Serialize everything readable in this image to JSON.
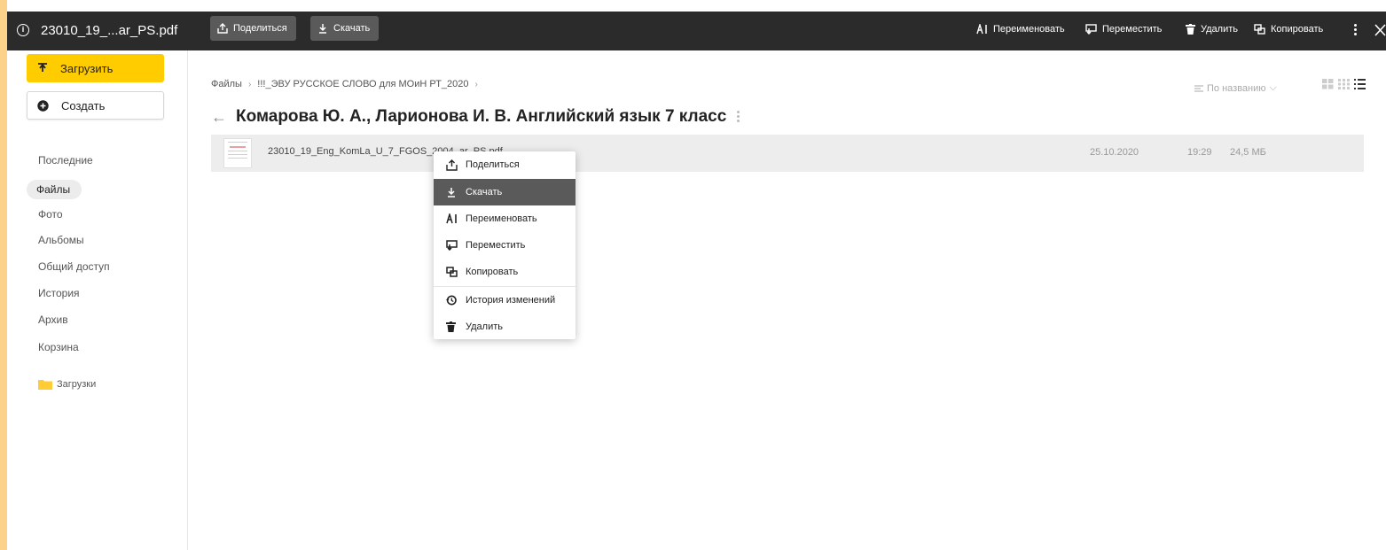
{
  "topbar": {
    "file_name": "23010_19_...ar_PS.pdf",
    "share_label": "Поделиться",
    "download_label": "Скачать",
    "rename_label": "Переименовать",
    "move_label": "Переместить",
    "delete_label": "Удалить",
    "copy_label": "Копировать"
  },
  "sidebar": {
    "upload_label": "Загрузить",
    "create_label": "Создать",
    "items": [
      {
        "label": "Последние"
      },
      {
        "label": "Файлы"
      },
      {
        "label": "Фото"
      },
      {
        "label": "Альбомы"
      },
      {
        "label": "Общий доступ"
      },
      {
        "label": "История"
      },
      {
        "label": "Архив"
      },
      {
        "label": "Корзина"
      }
    ],
    "folder_label": "Загрузки"
  },
  "main": {
    "breadcrumb": [
      "Файлы",
      "!!!_ЭВУ РУССКОЕ СЛОВО для МОиН РТ_2020"
    ],
    "title": "Комарова Ю. А., Ларионова И. В. Английский язык 7 класс",
    "sort_label": "По названию",
    "file": {
      "name": "23010_19_Eng_KomLa_U_7_FGOS_2004_ar_PS.pdf",
      "date": "25.10.2020",
      "time": "19:29",
      "size": "24,5 МБ"
    }
  },
  "context_menu": {
    "items": [
      {
        "label": "Поделиться",
        "icon": "share-icon"
      },
      {
        "label": "Скачать",
        "icon": "download-icon"
      },
      {
        "label": "Переименовать",
        "icon": "rename-icon"
      },
      {
        "label": "Переместить",
        "icon": "move-icon"
      },
      {
        "label": "Копировать",
        "icon": "copy-icon"
      },
      {
        "label": "История изменений",
        "icon": "history-icon"
      },
      {
        "label": "Удалить",
        "icon": "trash-icon"
      }
    ]
  },
  "colors": {
    "background": "#fcd28a",
    "topbar": "#2b2b2b",
    "accent": "#ffcc00",
    "selected": "#5a5a5a"
  }
}
